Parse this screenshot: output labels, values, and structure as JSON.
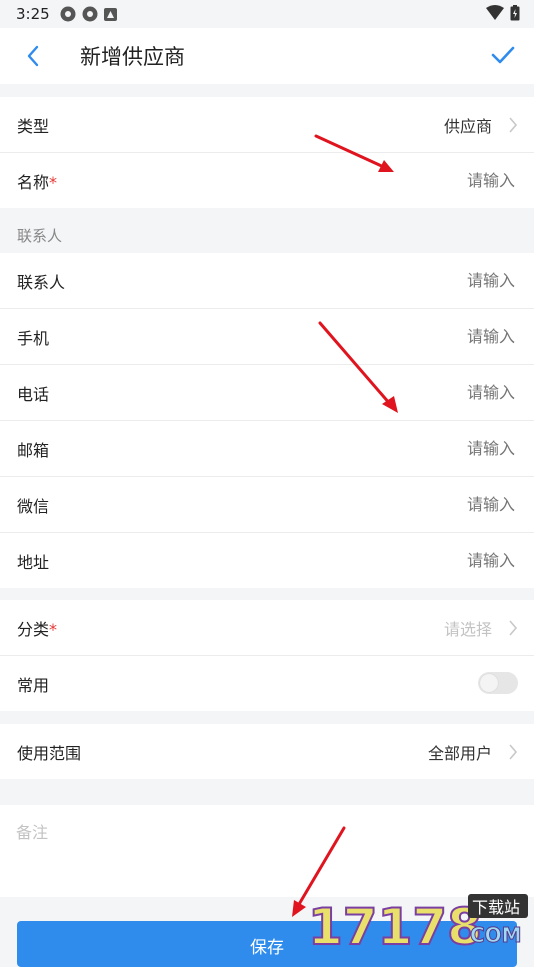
{
  "status": {
    "time": "3:25"
  },
  "header": {
    "title": "新增供应商"
  },
  "basic": {
    "type_label": "类型",
    "type_value": "供应商",
    "name_label": "名称",
    "name_required": "*",
    "name_placeholder": "请输入"
  },
  "contact_group": {
    "label": "联系人"
  },
  "contact": [
    {
      "label": "联系人",
      "placeholder": "请输入"
    },
    {
      "label": "手机",
      "placeholder": "请输入"
    },
    {
      "label": "电话",
      "placeholder": "请输入"
    },
    {
      "label": "邮箱",
      "placeholder": "请输入"
    },
    {
      "label": "微信",
      "placeholder": "请输入"
    },
    {
      "label": "地址",
      "placeholder": "请输入"
    }
  ],
  "category": {
    "label": "分类",
    "required": "*",
    "placeholder": "请选择"
  },
  "common": {
    "label": "常用",
    "enabled": false
  },
  "scope": {
    "label": "使用范围",
    "value": "全部用户"
  },
  "notes": {
    "placeholder": "备注"
  },
  "footer": {
    "save_label": "保存"
  },
  "watermark": {
    "text": "17178",
    "badge": "下载站",
    "suffix": "COM"
  },
  "colors": {
    "accent": "#2f8cec",
    "required": "#e53935",
    "annotation_arrow": "#e0141e"
  }
}
